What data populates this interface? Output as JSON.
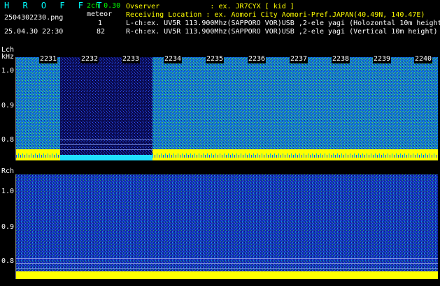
{
  "header": {
    "brand": "H R O F F T",
    "filename": "2504302230.png",
    "datetime": "25.04.30 22:30",
    "mode": "2ch 0.30",
    "type_label": "meteor",
    "lch_count": "1",
    "rch_count": "82",
    "observer": "Ovserver            : ex. JR7CYX [ kid ]",
    "location": "Receiving Location : ex. Aomori City Aomori-Pref.JAPAN(40.49N, 140.47E)",
    "lch_info": "L-ch:ex. UV5R 113.900Mhz(SAPPORO VOR)USB ,2-ele yagi (Holozontal 10m height)",
    "rch_info": "R-ch:ex. UV5R 113.900Mhz(SAPPORO VOR)USB ,2-ele yagi (Vertical 10m height)"
  },
  "lch_panel": {
    "label": "Lch",
    "unit": "kHz",
    "yticks": [
      "1.0",
      "0.9",
      "0.8"
    ],
    "time_ticks": [
      "2231",
      "2232",
      "2233",
      "2234",
      "2235",
      "2236",
      "2237",
      "2238",
      "2239",
      "2240"
    ],
    "meteor_window_minutes": [
      22.32,
      22.33
    ]
  },
  "rch_panel": {
    "label": "Rch",
    "yticks": [
      "1.0",
      "0.9",
      "0.8"
    ]
  },
  "colors": {
    "background": "#000000",
    "noise_cyan": "#00c8c8",
    "noise_blue": "#1a3cff",
    "noise_green": "#30c040",
    "carrier_yellow": "#ffff00",
    "header_cyan": "#00ffff",
    "header_green": "#00ff00"
  }
}
